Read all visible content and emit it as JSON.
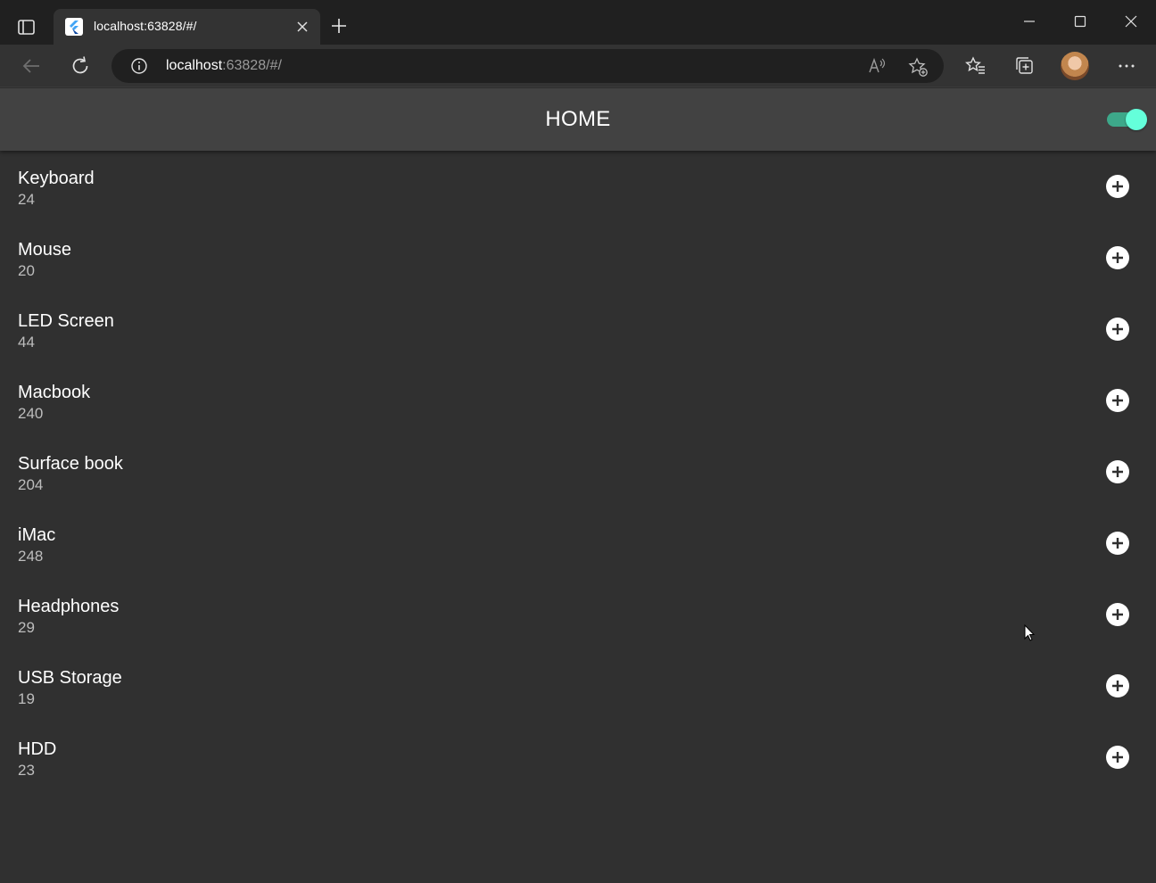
{
  "browser": {
    "tab_title": "localhost:63828/#/",
    "url_host": "localhost",
    "url_rest": ":63828/#/"
  },
  "app": {
    "title": "HOME",
    "dark_mode_enabled": true,
    "accent_color": "#64ffda"
  },
  "items": [
    {
      "name": "Keyboard",
      "value": "24"
    },
    {
      "name": "Mouse",
      "value": "20"
    },
    {
      "name": "LED Screen",
      "value": "44"
    },
    {
      "name": "Macbook",
      "value": "240"
    },
    {
      "name": "Surface book",
      "value": "204"
    },
    {
      "name": "iMac",
      "value": "248"
    },
    {
      "name": "Headphones",
      "value": "29"
    },
    {
      "name": "USB Storage",
      "value": "19"
    },
    {
      "name": "HDD",
      "value": "23"
    }
  ]
}
